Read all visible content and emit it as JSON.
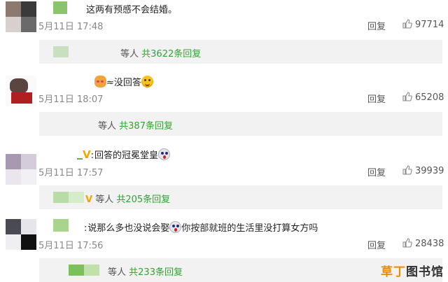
{
  "comments": [
    {
      "text": "这两有预感不会结婚。",
      "time": "5月11日 17:48",
      "reply_label": "回复",
      "likes": "97714",
      "sub_prefix": "等人",
      "sub_link": "共3622条回复"
    },
    {
      "text_prefix": "≈没回答",
      "time": "5月11日 18:07",
      "reply_label": "回复",
      "likes": "65208",
      "sub_prefix": "等人",
      "sub_link": "共387条回复"
    },
    {
      "text_prefix": "回答的冠冕堂皇",
      "time": "5月11日 17:57",
      "reply_label": "回复",
      "likes": "39939",
      "sub_prefix": "等人",
      "sub_link": "共205条回复"
    },
    {
      "text_prefix": "说那么多也没说会娶",
      "text_suffix": "你按部就班的生活里没打算女方吗",
      "time": "5月11日 17:56",
      "reply_label": "回复",
      "likes": "28438",
      "sub_prefix": "等人",
      "sub_link": "共233条回复"
    }
  ],
  "icons": {
    "like": "thumbs-up-icon",
    "emoji_smirk": "smirk-emoji-icon",
    "emoji_scared": "scared-emoji-icon",
    "emoji_blush": "blush-emoji-icon"
  },
  "colors": {
    "link_green": "#2ea52e",
    "badge_gold": "#f0a500",
    "subbox_bg": "#f2f2f2"
  },
  "watermark": {
    "part1": "草丁",
    "part2": "图书馆"
  }
}
